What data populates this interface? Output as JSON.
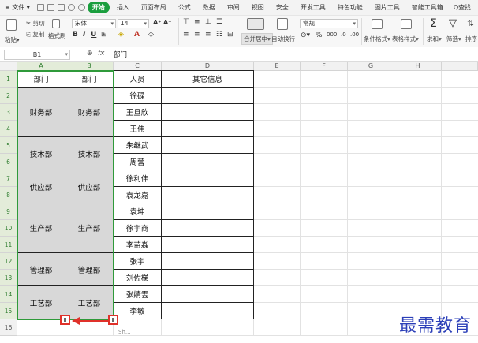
{
  "menubar": {
    "file": "≡ 文件 ▾",
    "tabs": [
      "开始",
      "插入",
      "页面布局",
      "公式",
      "数据",
      "审阅",
      "视图",
      "安全",
      "开发工具",
      "特色功能",
      "图片工具",
      "智能工具箱"
    ],
    "active_tab": "开始",
    "search": "Q查找"
  },
  "ribbon": {
    "paste": "粘贴▾",
    "cut": "✂ 剪切",
    "copy": "⎘ 复制",
    "format_painter": "格式刷",
    "font_name": "宋体",
    "font_size": "14",
    "merge_center": "合并居中▾",
    "wrap": "自动换行",
    "number_format": "常规",
    "cond_format": "条件格式▾",
    "table_style": "表格样式▾",
    "sum": "求和▾",
    "filter": "筛选▾",
    "sort": "排序"
  },
  "formula_bar": {
    "name_box": "B1",
    "fx": "fx",
    "content": "部门"
  },
  "columns": [
    "A",
    "B",
    "C",
    "D",
    "E",
    "F",
    "G",
    "H"
  ],
  "rows": [
    "1",
    "2",
    "3",
    "4",
    "5",
    "6",
    "7",
    "8",
    "9",
    "10",
    "11",
    "12",
    "13",
    "14",
    "15",
    "16"
  ],
  "table": {
    "headers": [
      "部门",
      "部门",
      "人员",
      "其它信息"
    ],
    "departments": [
      "财务部",
      "技术部",
      "供应部",
      "生产部",
      "管理部",
      "工艺部"
    ],
    "people": [
      "徐碌",
      "王旦欣",
      "王伟",
      "朱继武",
      "周营",
      "徐利伟",
      "袁龙嘉",
      "袁坤",
      "徐宇商",
      "李苗淼",
      "张宇",
      "刘佐梯",
      "张婧雲",
      "李敏"
    ]
  },
  "sheet_tab": "Sh...",
  "watermark": "最需教育",
  "colors": {
    "accent": "#1a9e3e",
    "selection": "#2f9a3a",
    "marker": "#e0312a",
    "merged_fill": "#d8d8d8",
    "watermark": "#2b3fb8"
  }
}
